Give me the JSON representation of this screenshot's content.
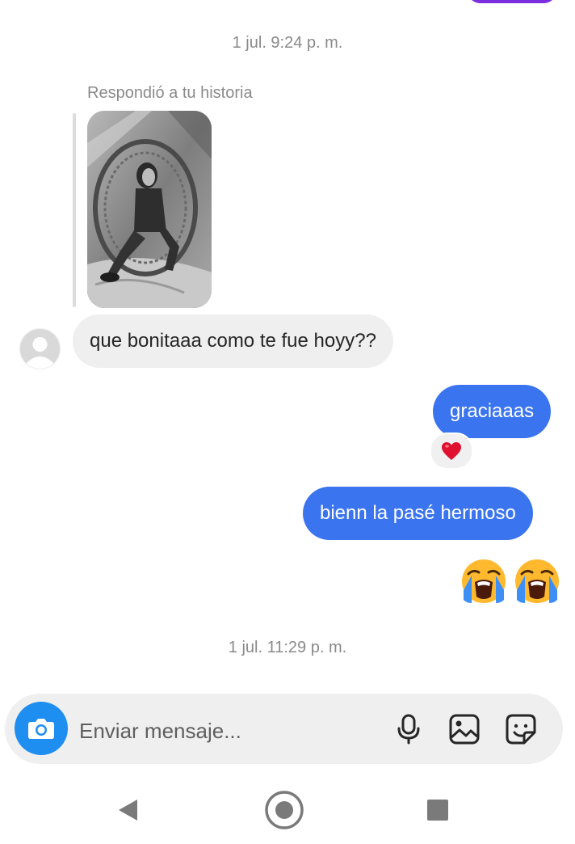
{
  "timestamps": [
    "1 jul. 9:24 p. m.",
    "1 jul. 11:29 p. m."
  ],
  "story_reply": {
    "label": "Respondió a tu historia"
  },
  "messages": [
    {
      "direction": "incoming",
      "text": "que bonitaaa como te fue hoyy??"
    },
    {
      "direction": "outgoing",
      "text": "graciaaas",
      "reaction": "heart"
    },
    {
      "direction": "outgoing",
      "text": "bienn la pasé hermoso"
    },
    {
      "direction": "outgoing",
      "emoji": [
        "loudly-crying-face",
        "loudly-crying-face"
      ]
    }
  ],
  "composer": {
    "placeholder": "Enviar mensaje...",
    "icons": [
      "camera-icon",
      "microphone-icon",
      "gallery-icon",
      "sticker-icon"
    ]
  },
  "navbar": {
    "icons": [
      "back-icon",
      "home-icon",
      "recents-icon"
    ]
  },
  "colors": {
    "outgoing_bubble": "#3a74ee",
    "incoming_bubble": "#efefef",
    "camera_button": "#1f8ef1",
    "previous_bubble": "#7a2ee0"
  }
}
